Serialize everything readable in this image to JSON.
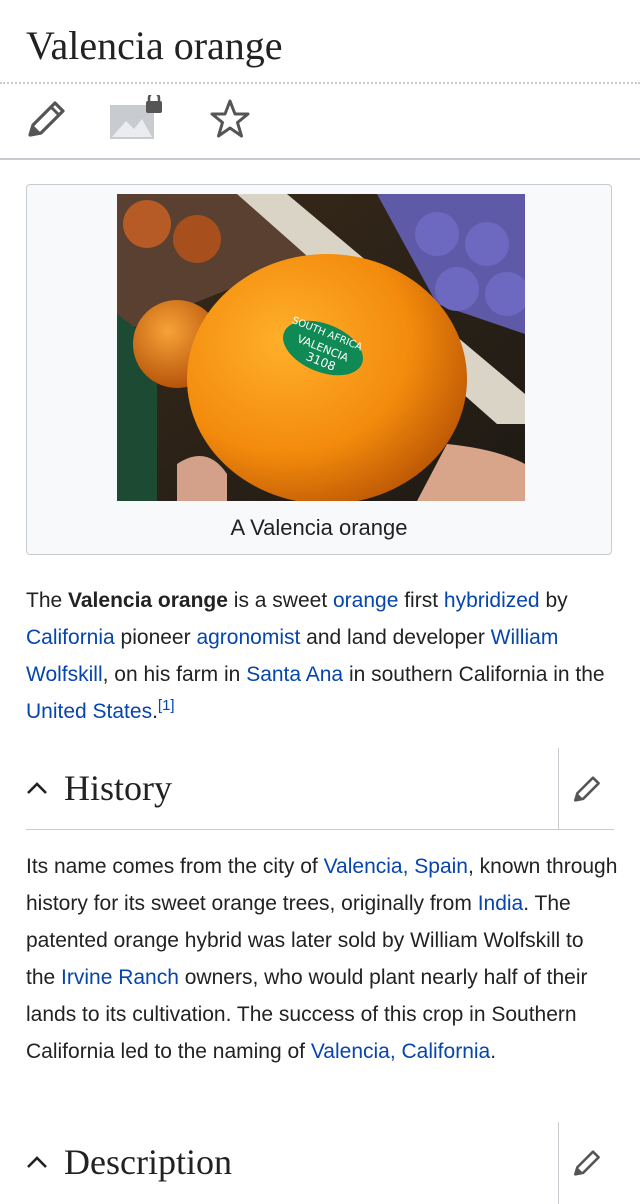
{
  "page": {
    "title": "Valencia orange"
  },
  "toolbar": {
    "items": [
      {
        "icon": "pencil-icon",
        "label": "Edit"
      },
      {
        "icon": "image-locked-icon",
        "label": "Upload image"
      },
      {
        "icon": "star-icon",
        "label": "Watch"
      }
    ]
  },
  "infobox": {
    "image_alt": "Valencia orange held in hand with sticker",
    "sticker_line1": "SOUTH AFRICA",
    "sticker_line2": "VALENCIA",
    "sticker_line3": "3108",
    "caption": "A Valencia orange"
  },
  "intro": {
    "t1": "The ",
    "b1": "Valencia orange",
    "t2": " is a sweet ",
    "l1": "orange",
    "t3": " first ",
    "l2": "hybridized",
    "t4": " by ",
    "l3": "California",
    "t5": " pioneer ",
    "l4": "agronomist",
    "t6": " and land developer ",
    "l5": "William Wolfskill",
    "t7": ", on his farm in ",
    "l6": "Santa Ana",
    "t8": " in southern California in the ",
    "l7": "United States",
    "t9": ".",
    "ref": "[1]"
  },
  "sections": {
    "history": {
      "title": "History",
      "p1": "Its name comes from the city of ",
      "l1": "Valencia, Spain",
      "p2": ", known through history for its sweet orange trees, originally from ",
      "l2": "India",
      "p3": ". The patented orange hybrid was later sold by William Wolfskill to the ",
      "l3": "Irvine Ranch",
      "p4": " owners, who would plant nearly half of their lands to its cultivation. The success of this crop in Southern California led to the naming of ",
      "l4": "Valencia, California",
      "p5": "."
    },
    "description": {
      "title": "Description"
    }
  },
  "colors": {
    "link": "#0645ad",
    "text": "#222222",
    "border": "#c8ccd1",
    "icon": "#555555"
  }
}
